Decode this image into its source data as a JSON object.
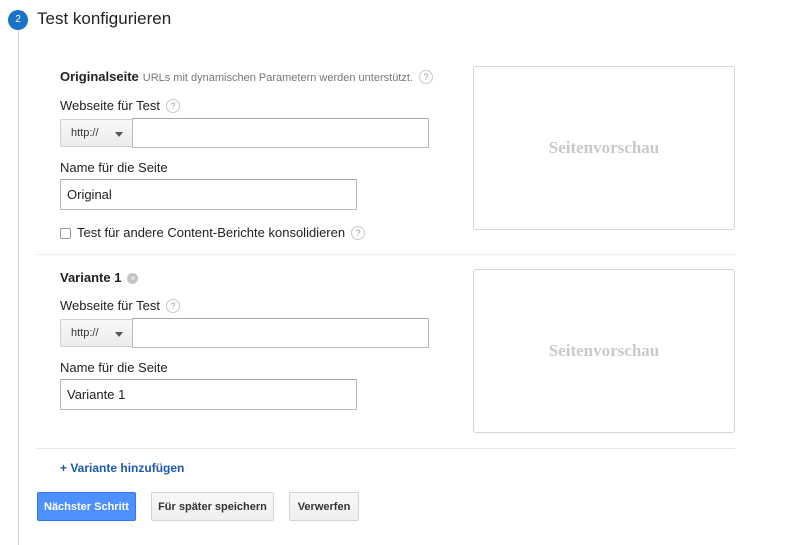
{
  "step": {
    "number": "2",
    "title": "Test konfigurieren"
  },
  "original": {
    "heading": "Originalseite",
    "hint": "URLs mit dynamischen Parametern werden unterstützt.",
    "url_label": "Webseite für Test",
    "protocol": "http://",
    "url_value": "",
    "name_label": "Name für die Seite",
    "name_value": "Original",
    "consolidate_label": "Test für andere Content-Berichte konsolidieren",
    "consolidate_checked": false,
    "preview_text": "Seitenvorschau"
  },
  "variant": {
    "heading": "Variante 1",
    "url_label": "Webseite für Test",
    "protocol": "http://",
    "url_value": "",
    "name_label": "Name für die Seite",
    "name_value": "Variante 1",
    "preview_text": "Seitenvorschau"
  },
  "add_variant_label": "+ Variante hinzufügen",
  "buttons": {
    "next": "Nächster Schritt",
    "save_later": "Für später speichern",
    "discard": "Verwerfen"
  },
  "icons": {
    "help": "?",
    "remove": "×"
  },
  "colors": {
    "accent": "#1a73c9",
    "primary_button": "#4d90fe",
    "link": "#1c5aa8"
  }
}
